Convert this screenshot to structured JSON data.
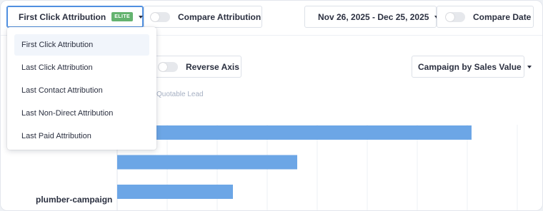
{
  "toolbar": {
    "attribution_label": "First Click Attribution",
    "attribution_badge": "ELITE",
    "compare_attribution_label": "Compare Attribution",
    "date_range_label": "Nov 26, 2025 - Dec 25, 2025",
    "compare_date_label": "Compare Date"
  },
  "attribution_menu": {
    "items": [
      {
        "label": "First Click Attribution",
        "selected": true
      },
      {
        "label": "Last Click Attribution"
      },
      {
        "label": "Last Contact Attribution"
      },
      {
        "label": "Last Non-Direct Attribution"
      },
      {
        "label": "Last Paid Attribution"
      }
    ]
  },
  "controls": {
    "reverse_axis_label": "Reverse Axis",
    "view_select_label": "Campaign by Sales Value"
  },
  "chart_data": {
    "type": "bar",
    "orientation": "horizontal",
    "legend_fragment": "Quotable Lead",
    "categories": [
      "",
      "",
      "plumber-campaign"
    ],
    "values": [
      99.2,
      50.4,
      32.4
    ],
    "xlim": [
      0,
      112
    ],
    "bar_color": "#6ca6e6",
    "grid": true
  },
  "colors": {
    "accent": "#4f8fe0",
    "badge": "#64b36f",
    "bar": "#6ca6e6"
  }
}
